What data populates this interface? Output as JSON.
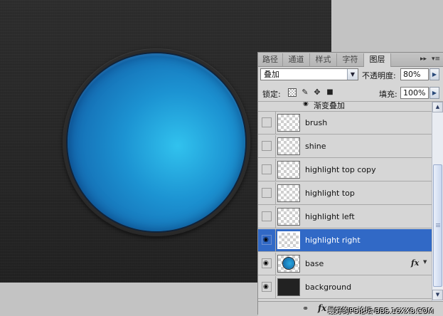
{
  "canvas": {
    "orb_color": "#1c93d2",
    "background_color": "#282828"
  },
  "tabs": [
    {
      "label": "路径",
      "active": false
    },
    {
      "label": "通道",
      "active": false
    },
    {
      "label": "样式",
      "active": false
    },
    {
      "label": "字符",
      "active": false
    },
    {
      "label": "图层",
      "active": true
    }
  ],
  "tab_controls": {
    "collapse": "▸▸",
    "menu": "▾≡"
  },
  "blend": {
    "mode": "叠加",
    "opacity_label": "不透明度:",
    "opacity": "80%"
  },
  "lock": {
    "label": "锁定:",
    "fill_label": "填充:",
    "fill": "100%"
  },
  "effect_row": {
    "label": "渐变叠加"
  },
  "layers": [
    {
      "name": "brush",
      "visible": false,
      "selected": false
    },
    {
      "name": "shine",
      "visible": false,
      "selected": false
    },
    {
      "name": "highlight top copy",
      "visible": false,
      "selected": false
    },
    {
      "name": "highlight top",
      "visible": false,
      "selected": false
    },
    {
      "name": "highlight left",
      "visible": false,
      "selected": false
    },
    {
      "name": "highlight right",
      "visible": true,
      "selected": true
    },
    {
      "name": "base",
      "visible": true,
      "selected": false,
      "has_fx": true
    },
    {
      "name": "background",
      "visible": true,
      "selected": false
    }
  ],
  "fx_label": "fx",
  "footer": {
    "fx": "fx",
    "watermark": "最好的PS论坛-BBS.16XX8.COM"
  },
  "colors": {
    "selection": "#3169c6",
    "panel": "#d6d6d6"
  }
}
